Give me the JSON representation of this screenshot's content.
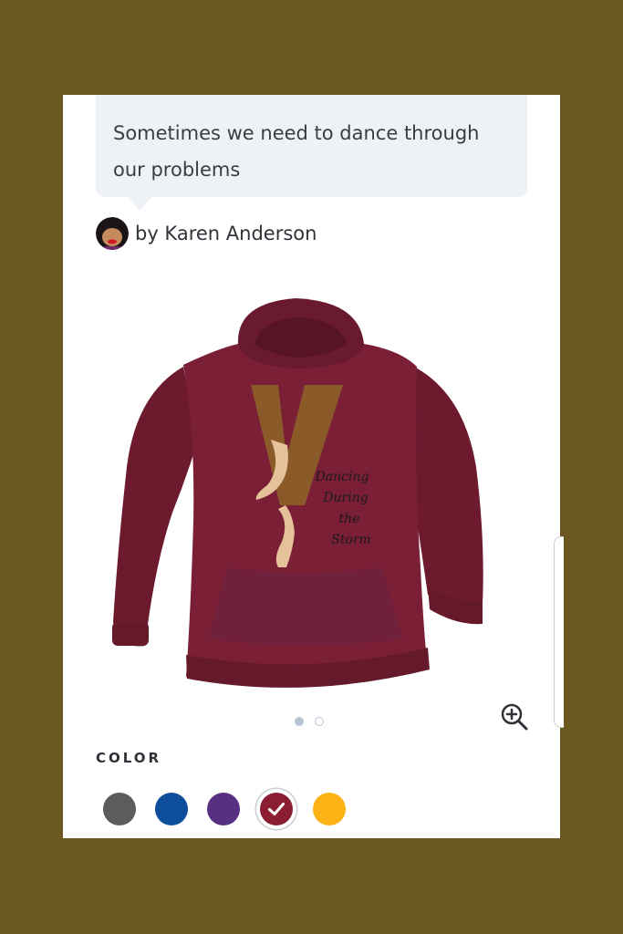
{
  "product": {
    "description": "Sometimes we need to dance through our problems",
    "author": "by Karen Anderson",
    "shirt_text": [
      "Dancing",
      "During",
      "the",
      "Storm"
    ]
  },
  "gallery": {
    "active_index": 0,
    "count": 2
  },
  "color": {
    "label": "COLOR",
    "swatches": [
      {
        "name": "gray",
        "hex": "#5c5c5c",
        "selected": false
      },
      {
        "name": "royal",
        "hex": "#0e4f9c",
        "selected": false
      },
      {
        "name": "purple",
        "hex": "#573081",
        "selected": false
      },
      {
        "name": "maroon",
        "hex": "#8b1e33",
        "selected": true
      },
      {
        "name": "gold",
        "hex": "#fdb215",
        "selected": false
      }
    ]
  },
  "colors": {
    "page_bg": "#6b5720",
    "hoodie": "#7a1f36",
    "bubble_bg": "#eef2f7"
  },
  "icons": [
    "avatar",
    "zoom-in-icon",
    "check-icon"
  ]
}
